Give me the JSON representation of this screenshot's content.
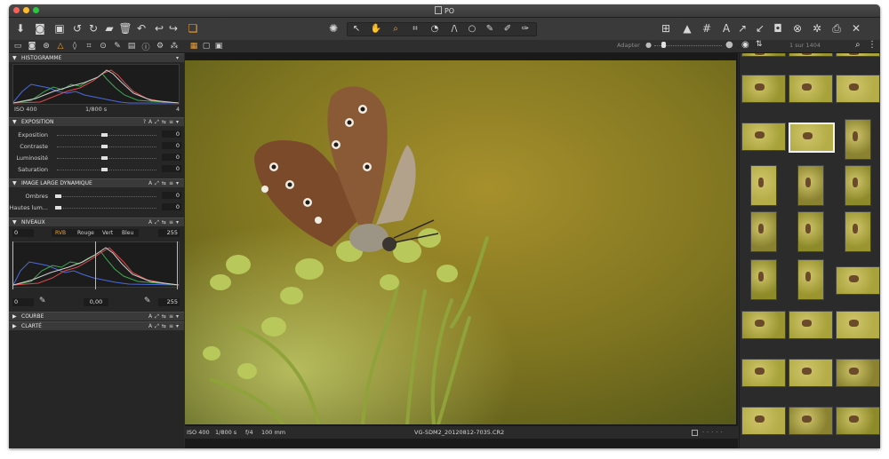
{
  "window": {
    "title": "PO"
  },
  "view_controls": {
    "adapter_label": "Adapter"
  },
  "browser": {
    "counter": "1 sur 1404"
  },
  "panels": {
    "histogram": {
      "title": "HISTOGRAMME",
      "iso": "ISO 400",
      "shutter": "1/800 s",
      "aperture": "4"
    },
    "exposure": {
      "title": "EXPOSITION",
      "sliders": [
        {
          "label": "Exposition",
          "value": "0"
        },
        {
          "label": "Contraste",
          "value": "0"
        },
        {
          "label": "Luminosité",
          "value": "0"
        },
        {
          "label": "Saturation",
          "value": "0"
        }
      ]
    },
    "hdr": {
      "title": "IMAGE LARGE DYNAMIQUE",
      "sliders": [
        {
          "label": "Ombres",
          "value": "0"
        },
        {
          "label": "Hautes lum...",
          "value": "0"
        }
      ]
    },
    "levels": {
      "title": "NIVEAUX",
      "input_low": "0",
      "input_high": "255",
      "channels": [
        "RVB",
        "Rouge",
        "Vert",
        "Bleu"
      ],
      "active_channel": "RVB",
      "output_low": "0",
      "gamma": "0,00",
      "output_high": "255"
    },
    "curve": {
      "title": "COURBE"
    },
    "clarity": {
      "title": "CLARTÉ"
    }
  },
  "viewer": {
    "iso": "ISO 400",
    "shutter": "1/800 s",
    "aperture": "f/4",
    "focal": "100 mm",
    "filename": "VG-5DM2_20120812-7035.CR2"
  },
  "colors": {
    "accent": "#f0a030",
    "window_bg": "#2b2b2b",
    "panel_bg": "#262626"
  }
}
